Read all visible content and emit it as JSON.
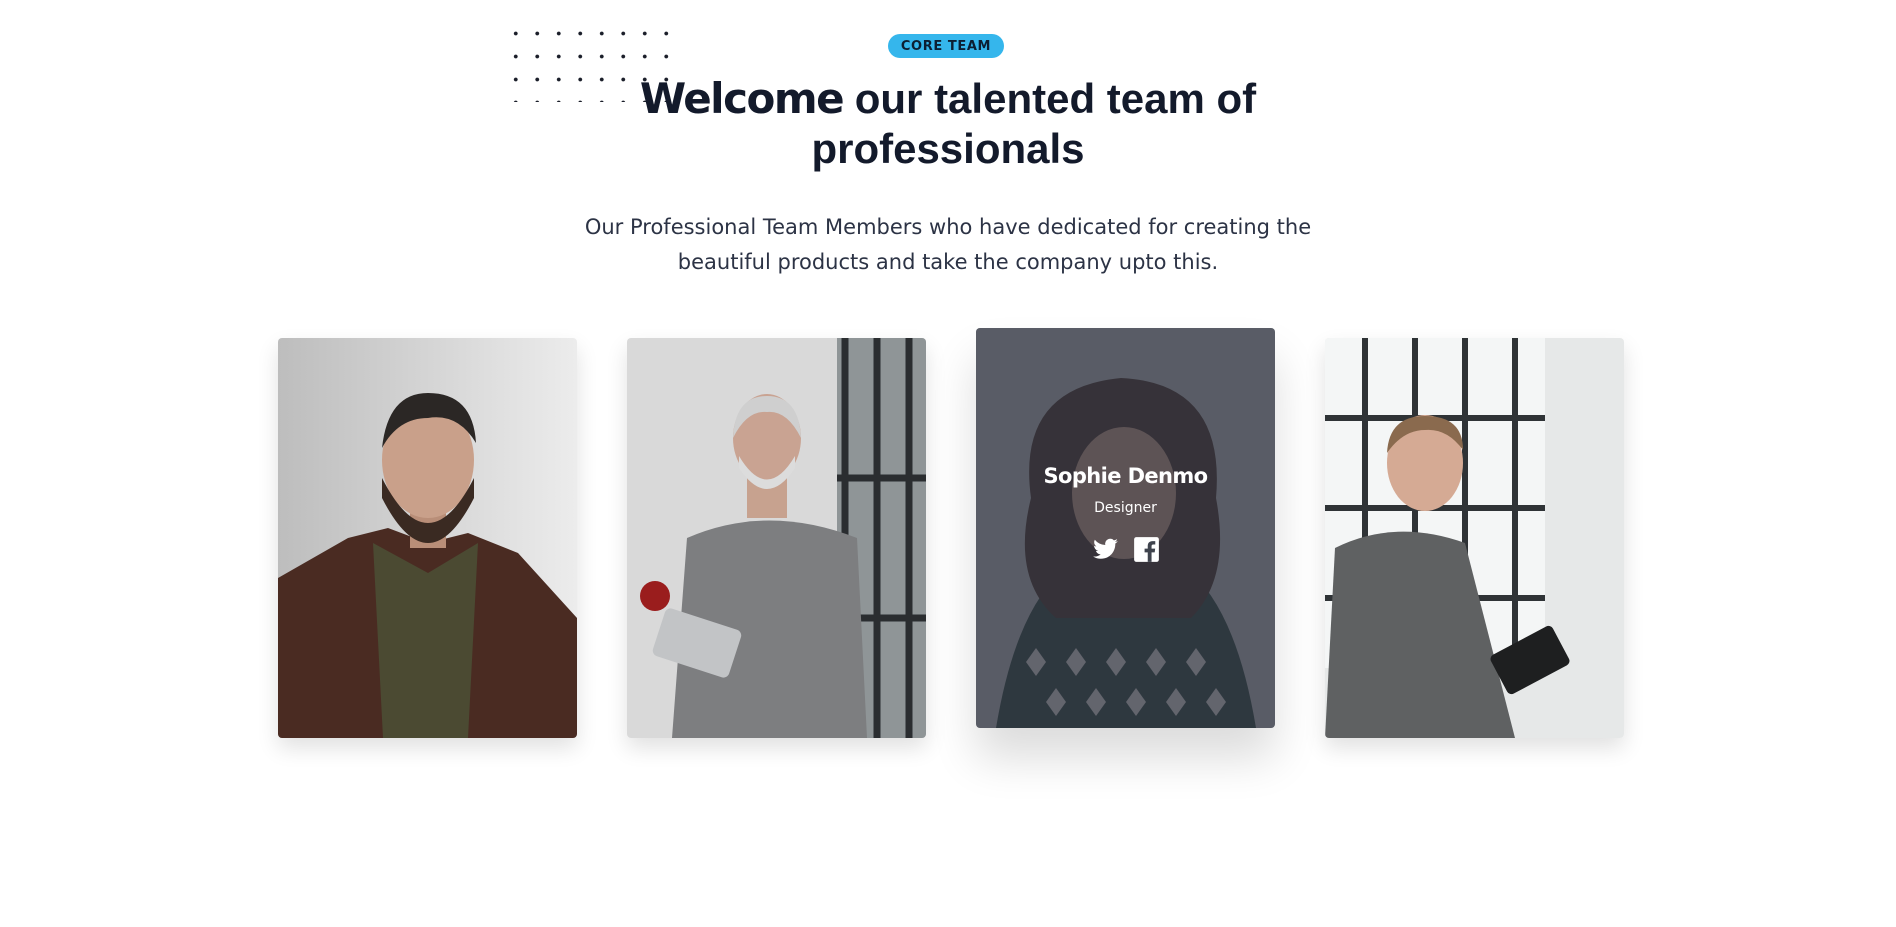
{
  "section": {
    "badge": "CORE TEAM",
    "title_strong": "Welcome",
    "title_rest": " our talented team of professionals",
    "subtitle": "Our Professional Team Members who have dedicated for creating the beautiful products and take the company upto this."
  },
  "team": [
    {
      "name": "",
      "role": "",
      "photo": "bearded-man-in-brown-blazer"
    },
    {
      "name": "",
      "role": "",
      "photo": "gray-haired-man-with-apple-and-tablet"
    },
    {
      "name": "Sophie Denmo",
      "role": "Designer",
      "photo": "curly-haired-woman-in-patterned-shirt",
      "socials": [
        "twitter-icon",
        "facebook-icon"
      ]
    },
    {
      "name": "",
      "role": "",
      "photo": "smiling-man-with-tablet-by-window"
    }
  ],
  "colors": {
    "accent": "#35b6ec",
    "heading": "#131a2b",
    "overlay": "#343842"
  }
}
